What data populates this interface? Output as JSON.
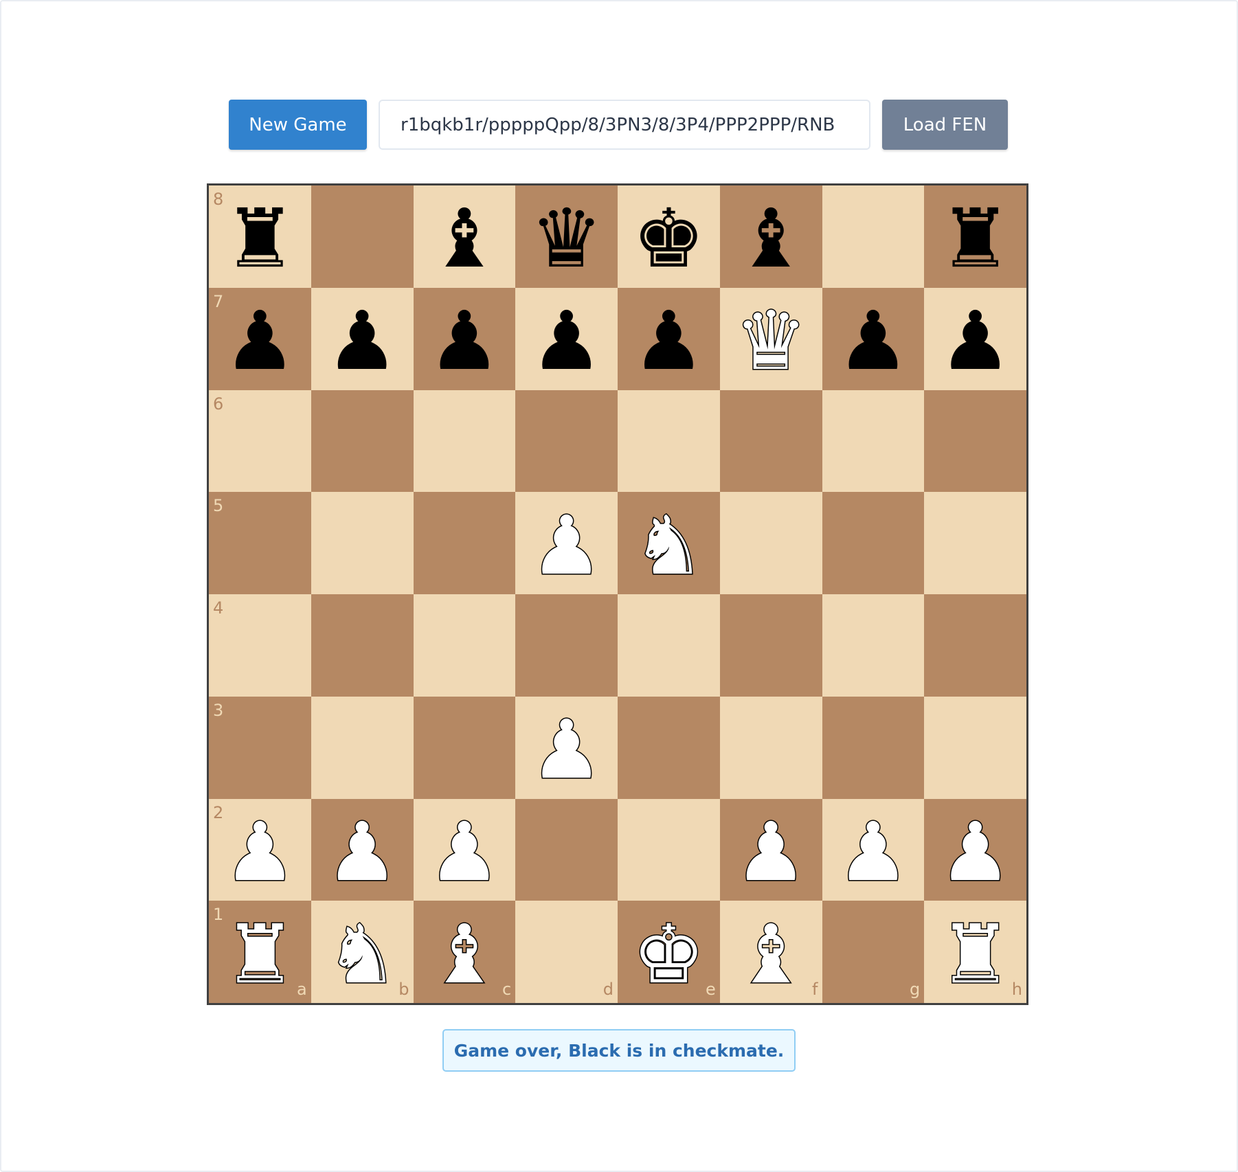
{
  "controls": {
    "new_game_label": "New Game",
    "fen_value": "r1bqkb1r/pppppQpp/8/3PN3/8/3P4/PPP2PPP/RNB",
    "load_fen_label": "Load FEN"
  },
  "board": {
    "files": [
      "a",
      "b",
      "c",
      "d",
      "e",
      "f",
      "g",
      "h"
    ],
    "ranks": [
      "8",
      "7",
      "6",
      "5",
      "4",
      "3",
      "2",
      "1"
    ],
    "light_color": "#f0d9b5",
    "dark_color": "#b58863",
    "rows": [
      [
        "br",
        "",
        "bb",
        "bq",
        "bk",
        "bb",
        "",
        "br"
      ],
      [
        "bp",
        "bp",
        "bp",
        "bp",
        "bp",
        "wq",
        "bp",
        "bp"
      ],
      [
        "",
        "",
        "",
        "",
        "",
        "",
        "",
        ""
      ],
      [
        "",
        "",
        "",
        "wp",
        "wn",
        "",
        "",
        ""
      ],
      [
        "",
        "",
        "",
        "",
        "",
        "",
        "",
        ""
      ],
      [
        "",
        "",
        "",
        "wp",
        "",
        "",
        "",
        ""
      ],
      [
        "wp",
        "wp",
        "wp",
        "",
        "",
        "wp",
        "wp",
        "wp"
      ],
      [
        "wr",
        "wn",
        "wb",
        "",
        "wk",
        "wb",
        "",
        "wr"
      ]
    ]
  },
  "status": {
    "message": "Game over, Black is in checkmate."
  },
  "colors": {
    "primary_button": "#3182ce",
    "secondary_button": "#718096",
    "status_background": "#ebf8ff",
    "status_text": "#2b6cb0"
  }
}
